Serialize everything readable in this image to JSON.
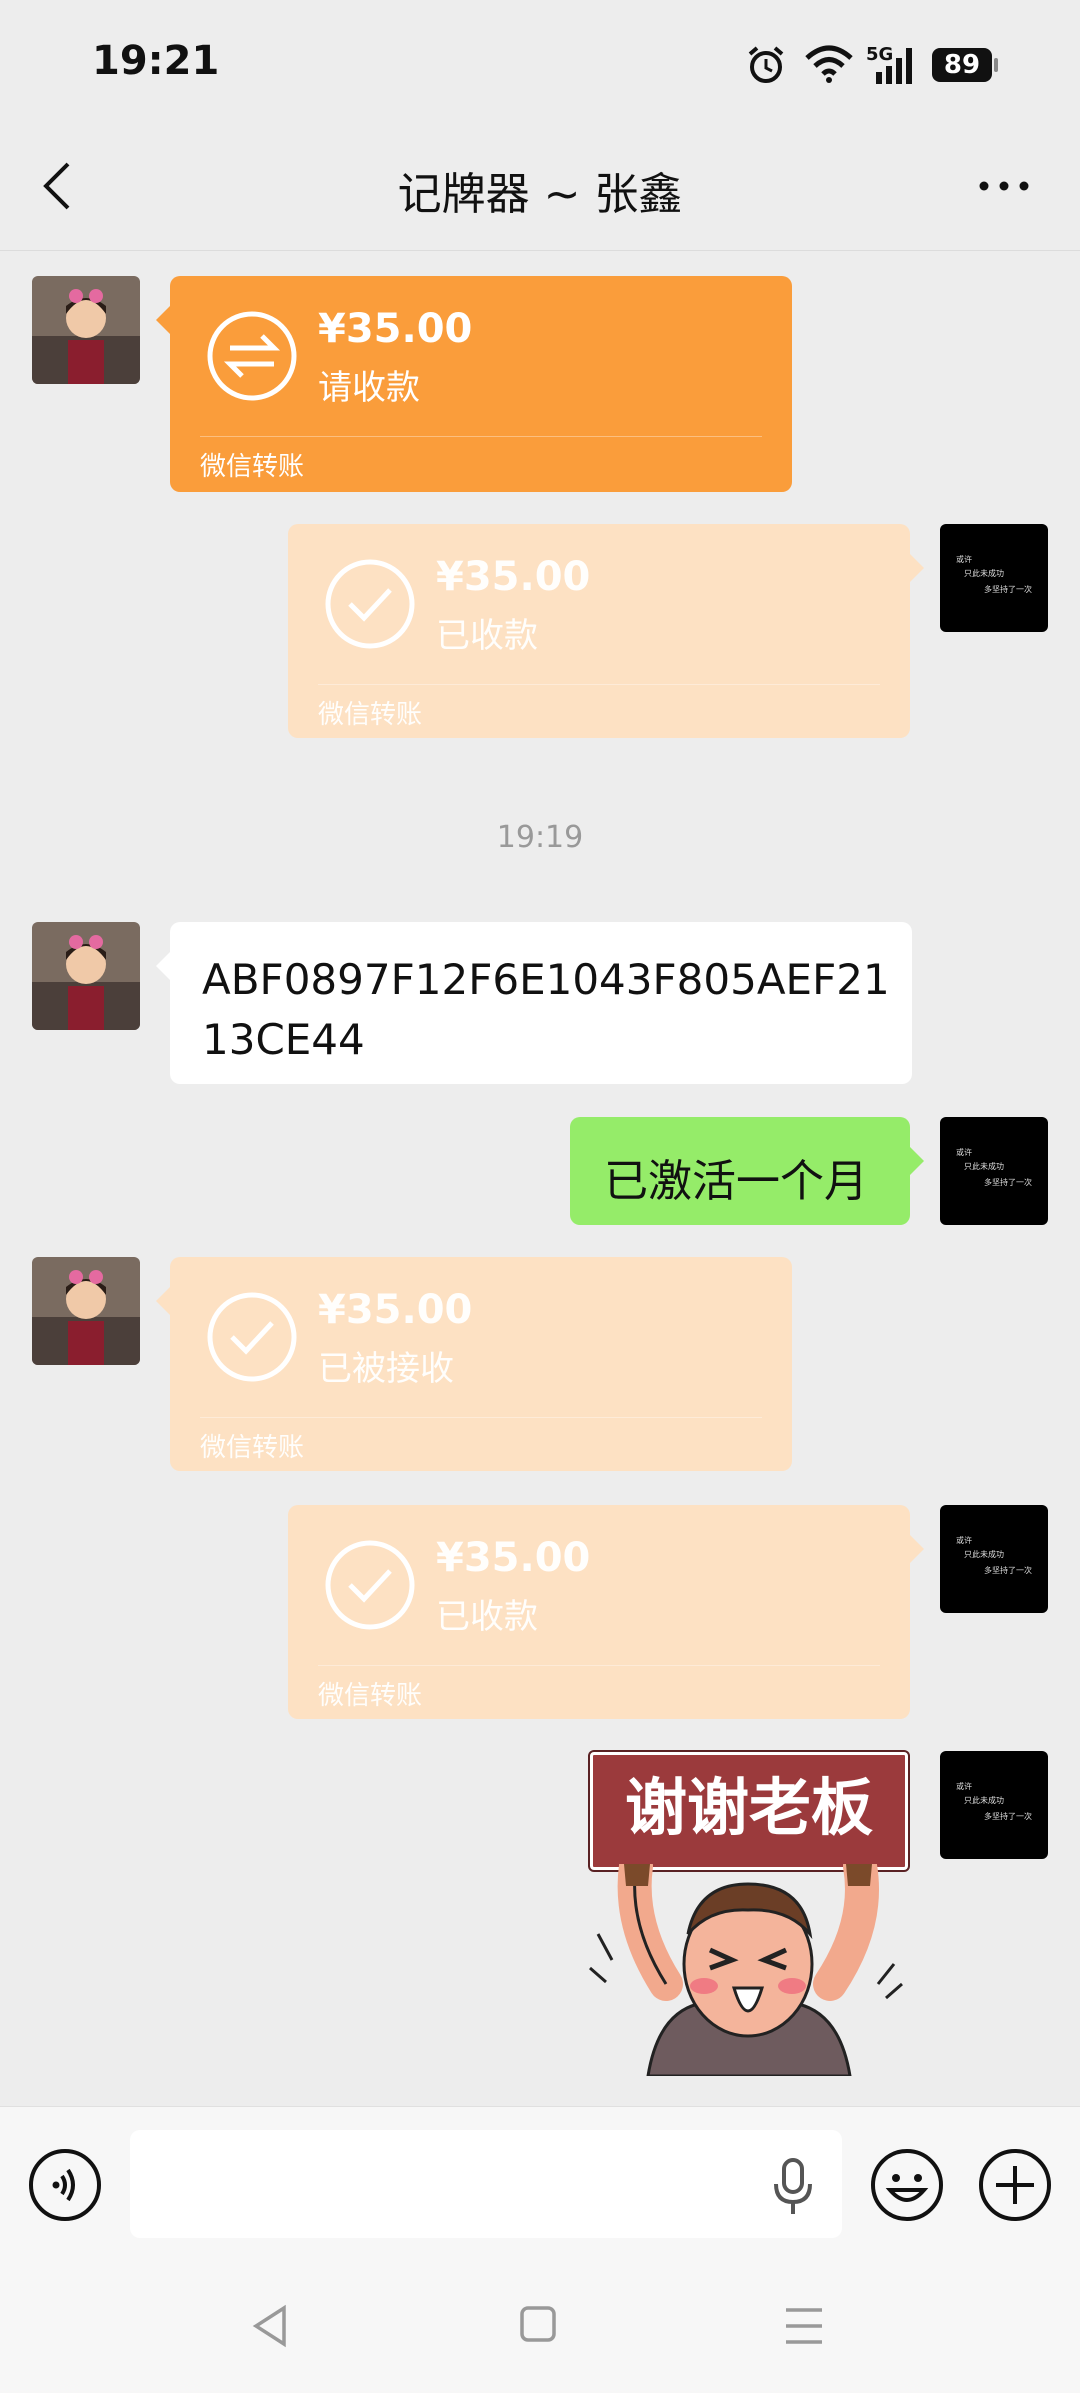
{
  "status_bar": {
    "time": "19:21",
    "network": "5G",
    "battery": "89",
    "icons": [
      "alarm-icon",
      "wifi-icon",
      "signal-icon",
      "battery-icon"
    ]
  },
  "nav": {
    "title": "记牌器 ~ 张鑫",
    "back_icon": "back-chevron-icon",
    "more_icon": "more-dots-icon"
  },
  "messages": [
    {
      "side": "left",
      "type": "transfer",
      "amount": "¥35.00",
      "status": "请收款",
      "footer": "微信转账",
      "color": "#fa9d3b"
    },
    {
      "side": "right",
      "type": "transfer",
      "amount": "¥35.00",
      "status": "已收款",
      "footer": "微信转账",
      "color": "#fde1c3"
    },
    {
      "type": "timestamp",
      "text": "19:19"
    },
    {
      "side": "left",
      "type": "text",
      "text_line1": "ABF0897F12F6E1043F805AEF21",
      "text_line2": "13CE44"
    },
    {
      "side": "right",
      "type": "text",
      "text": "已激活一个月"
    },
    {
      "side": "left",
      "type": "transfer",
      "amount": "¥35.00",
      "status": "已被接收",
      "footer": "微信转账",
      "color": "#fde1c3"
    },
    {
      "side": "right",
      "type": "transfer",
      "amount": "¥35.00",
      "status": "已收款",
      "footer": "微信转账",
      "color": "#fde1c3"
    },
    {
      "side": "right",
      "type": "sticker",
      "text": "谢谢老板"
    }
  ],
  "right_avatar": {
    "line1": "或许",
    "line2": "只此未成功",
    "line3": "多坚持了一次"
  },
  "input_bar": {
    "voice_icon": "voice-icon",
    "mic_icon": "microphone-icon",
    "emoji_icon": "emoji-icon",
    "plus_icon": "plus-icon"
  },
  "colors": {
    "chat_bg": "#ededed",
    "green_bubble": "#95ec69",
    "transfer_orange": "#fa9d3b",
    "transfer_pale": "#fde1c3"
  }
}
